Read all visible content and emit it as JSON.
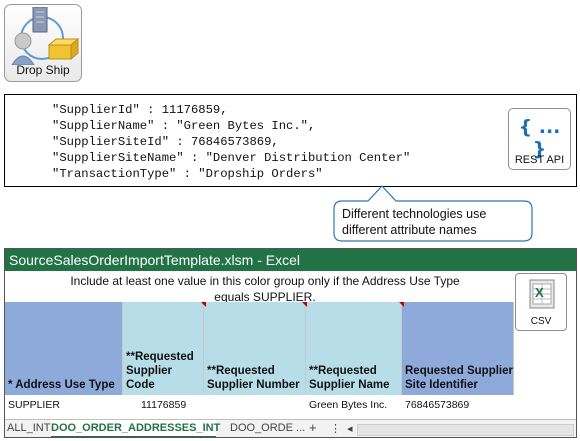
{
  "dropship": {
    "label": "Drop Ship"
  },
  "rest_payload": {
    "lines": [
      "\"SupplierId\" : 11176859,",
      "\"SupplierName\" : \"Green Bytes Inc.\",",
      "\"SupplierSiteId\" : 76846573869,",
      "\"SupplierSiteName\" : \"Denver Distribution Center\"",
      "\"TransactionType\" : \"Dropship Orders\""
    ]
  },
  "rest_api": {
    "label": "REST API",
    "braces": "{ ... }"
  },
  "callout": {
    "text": "Different technologies use different attribute names"
  },
  "excel": {
    "title": "SourceSalesOrderImportTemplate.xlsm - Excel",
    "note": "Include at least one value in this color group only if the Address Use Type equals SUPPLIER.",
    "csv_label": "CSV",
    "columns": [
      {
        "header": "* Address Use Type",
        "value": "SUPPLIER"
      },
      {
        "header": "**Requested Supplier Code",
        "value": "11176859"
      },
      {
        "header": "**Requested Supplier Number",
        "value": ""
      },
      {
        "header": "**Requested Supplier Name",
        "value": "Green Bytes Inc."
      },
      {
        "header": "Requested Supplier Site Identifier",
        "value": "76846573869"
      }
    ],
    "tabs": {
      "left": "ALL_INT",
      "active": "DOO_ORDER_ADDRESSES_INT",
      "next": "DOO_ORDE ...",
      "add": "+",
      "more": "⋮",
      "prev": "◂"
    },
    "colors": {
      "blue_header": "#8eaadb",
      "teal_header": "#b7dee8",
      "title_bar": "#217346"
    }
  }
}
